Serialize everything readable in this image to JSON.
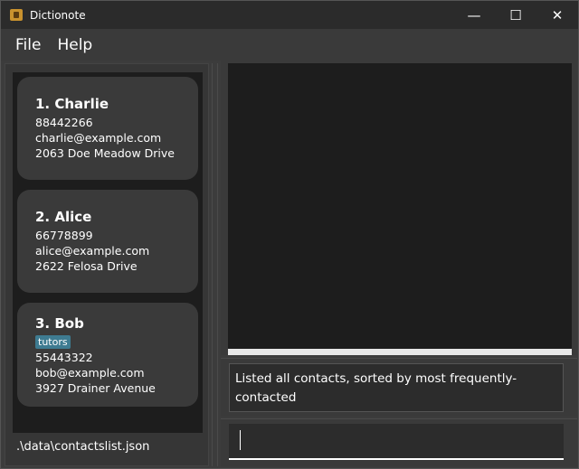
{
  "window": {
    "title": "Dictionote",
    "minimize": "—",
    "maximize": "☐",
    "close": "✕"
  },
  "menu": {
    "file": "File",
    "help": "Help"
  },
  "contacts": [
    {
      "index_name": "1.  Charlie",
      "tag": "",
      "phone": "88442266",
      "email": "charlie@example.com",
      "address": "2063 Doe Meadow Drive"
    },
    {
      "index_name": "2.  Alice",
      "tag": "",
      "phone": "66778899",
      "email": "alice@example.com",
      "address": "2622 Felosa Drive"
    },
    {
      "index_name": "3.  Bob",
      "tag": "tutors",
      "phone": "55443322",
      "email": "bob@example.com",
      "address": "3927 Drainer Avenue"
    }
  ],
  "status": {
    "file_path": ".\\data\\contactslist.json"
  },
  "result": {
    "message": "Listed all contacts, sorted by most frequently-contacted"
  },
  "command": {
    "value": ""
  }
}
